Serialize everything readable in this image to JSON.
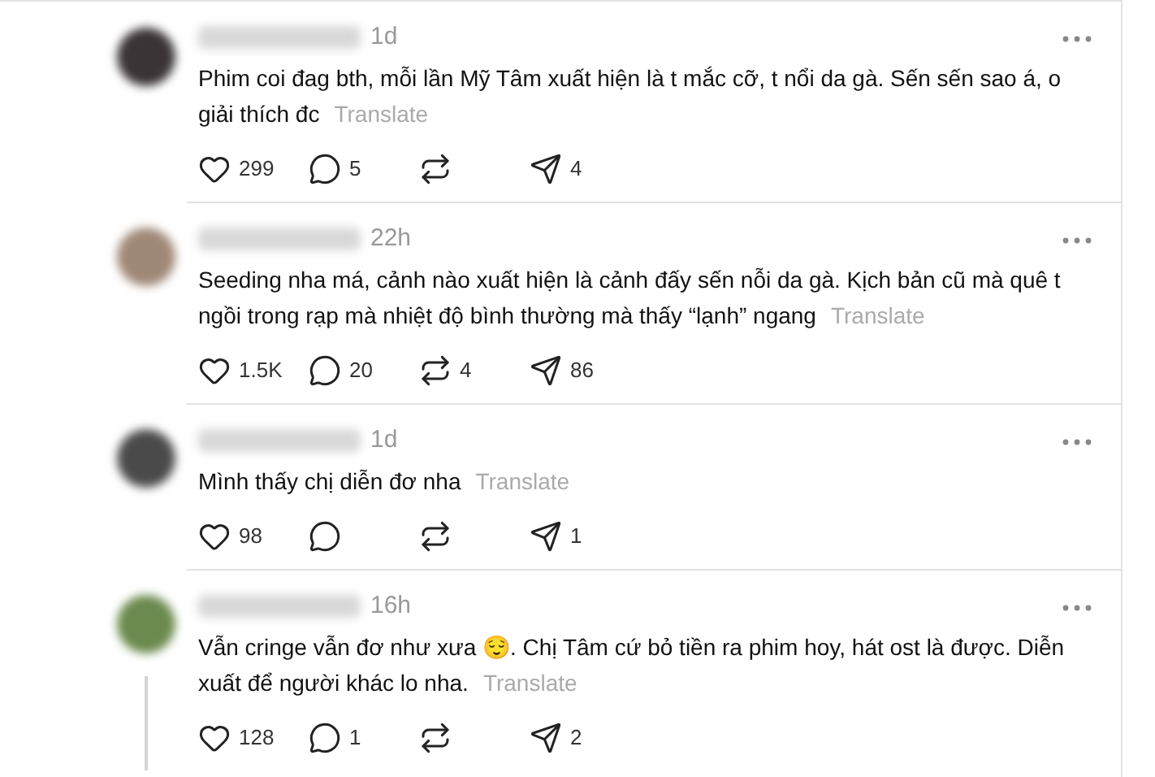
{
  "comments": [
    {
      "time": "1d",
      "text": "Phim coi đag bth, mỗi lần Mỹ Tâm xuất hiện là t mắc cỡ, t nổi da gà. Sến sến sao á, o giải thích đc",
      "translate": "Translate",
      "likes": "299",
      "replies": "5",
      "shares": "4",
      "thread": false
    },
    {
      "time": "22h",
      "text": "Seeding nha má, cảnh nào xuất hiện là cảnh đấy sến nỗi da gà. Kịch bản cũ mà quê t ngồi trong rạp mà nhiệt độ bình thường mà thấy “lạnh” ngang",
      "translate": "Translate",
      "likes": "1.5K",
      "replies": "20",
      "reposts": "4",
      "shares": "86",
      "thread": false
    },
    {
      "time": "1d",
      "text": "Mình thấy chị diễn đơ nha",
      "translate": "Translate",
      "likes": "98",
      "shares": "1",
      "thread": false
    },
    {
      "time": "16h",
      "text": "Vẫn cringe vẫn đơ như xưa 😌. Chị Tâm cứ bỏ tiền ra phim hoy, hát ost là được. Diễn xuất để người khác lo nha.",
      "translate": "Translate",
      "likes": "128",
      "replies": "1",
      "shares": "2",
      "thread": true
    }
  ]
}
